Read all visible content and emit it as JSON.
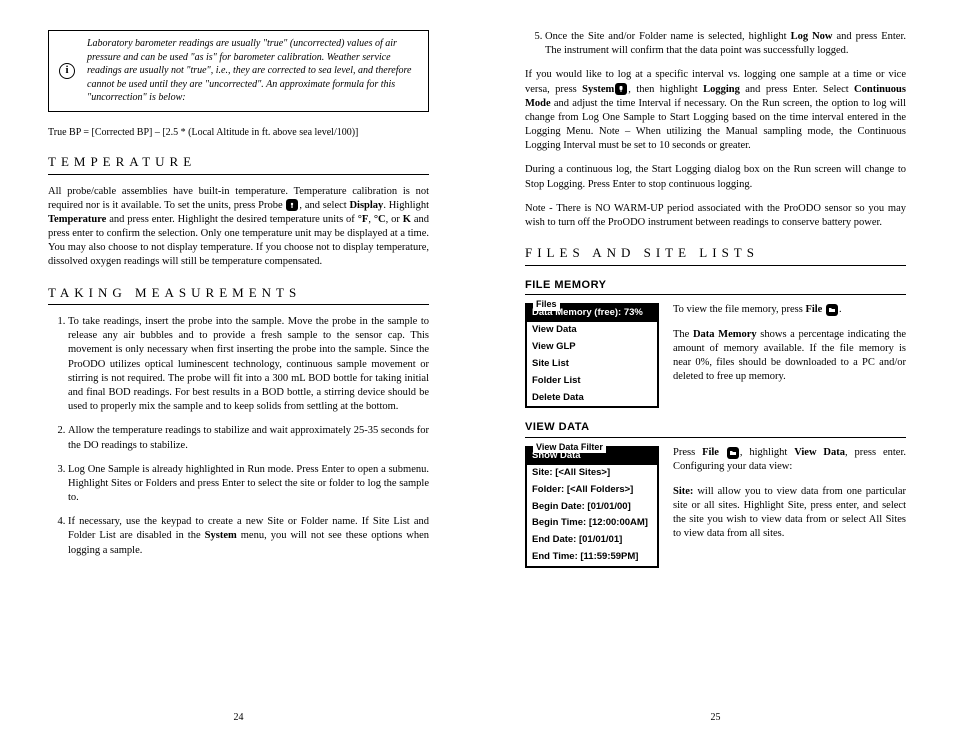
{
  "left": {
    "infoIcon": "i",
    "infoBox": "Laboratory barometer readings are usually \"true\" (uncorrected) values of air pressure and can be used \"as is\" for barometer calibration.  Weather service readings are usually not \"true\", i.e., they are corrected to sea level, and therefore cannot be used until they are \"uncorrected\".  An approximate formula for this \"uncorrection\" is below:",
    "formula": "True BP = [Corrected BP] – [2.5 * (Local Altitude in ft. above sea level/100)]",
    "tempHeading": "Temperature",
    "tempPara1a": "All probe/cable assemblies have built-in temperature.  Temperature calibration is not required nor is it available.  To set the units, press Probe ",
    "tempPara1b": ", and select ",
    "tempDisplay": "Display",
    "tempPara1c": ".  Highlight ",
    "tempTemperature": "Temperature",
    "tempPara1d": " and press enter.  Highlight the desired temperature units of ",
    "tempF": "°F",
    "tempC": "°C",
    "tempOr": ", or ",
    "tempK": "K",
    "tempPara1e": " and press enter to confirm the selection.   Only one temperature unit may be displayed at a time.  You may also choose to not display temperature.  If you choose not to display temperature, dissolved oxygen readings will still be temperature compensated.",
    "takingHeading": "Taking Measurements",
    "steps": [
      "To take readings, insert the probe into the sample.  Move the probe in the sample to release any air bubbles and to provide a fresh sample to the sensor cap.  This movement is only necessary when first inserting the probe into the sample.  Since the ProODO utilizes optical luminescent technology, continuous sample movement or stirring is not required.  The probe will fit into a 300 mL BOD bottle for taking initial and final BOD readings.  For best results in a BOD bottle, a stirring device should be used to properly mix the sample and to keep solids from settling at the bottom.",
      "Allow the temperature readings to stabilize and wait approximately 25-35 seconds for the DO readings to stabilize.",
      "Log One Sample is already highlighted in Run mode.  Press Enter to open a submenu.  Highlight Sites or Folders and press Enter to select the site or folder to log the sample to.",
      "If necessary, use the keypad to create a new Site or Folder name. If Site List and Folder List are disabled in the <b>System</b> menu, you will not see these options when logging a sample."
    ],
    "pageNum": "24"
  },
  "right": {
    "step5a": "Once the Site and/or Folder name is selected, highlight ",
    "step5LogNow": "Log Now",
    "step5b": " and press Enter.  The instrument will confirm that the data point was successfully logged.",
    "para1a": "If you would like to log at a specific interval vs. logging one sample at a time or vice versa, press ",
    "para1System": "System",
    "para1b": ", then highlight ",
    "para1Logging": "Logging",
    "para1c": " and press Enter.  Select ",
    "para1Cont": "Continuous Mode",
    "para1d": " and adjust the time Interval if necessary.   On the Run screen, the option to log will change from Log One Sample to Start Logging based on the time interval entered in the Logging Menu.  Note – When utilizing the Manual sampling mode, the  Continuous Logging Interval must be set to 10 seconds or greater.",
    "para2": "During a continuous log, the Start Logging dialog box on the Run screen will change to Stop Logging.  Press Enter to stop continuous logging.",
    "para3": "Note - There is NO WARM-UP period associated with the ProODO sensor so you may wish to turn off the ProODO instrument between readings to conserve battery power.",
    "filesHeading": "Files and Site Lists",
    "fileMemHeading": "File Memory",
    "fileMenu": {
      "legend": "Files",
      "highlight": "Data Memory (free): 73%",
      "rows": [
        "View Data",
        "View GLP",
        "Site List",
        "Folder List",
        "Delete Data"
      ]
    },
    "fileDesc1a": "To view the file memory, press ",
    "fileDesc1File": "File",
    "fileDesc1b": ".",
    "fileDesc2a": "The ",
    "fileDesc2DM": "Data Memory",
    "fileDesc2b": " shows a percentage indicating the amount of memory available.  If the file memory is near 0%, files should be downloaded to a PC and/or deleted to free up memory.",
    "viewDataHeading": "View Data",
    "viewMenu": {
      "legend": "View Data Filter",
      "highlight": "Show Data",
      "rows": [
        "Site: [<All Sites>]",
        "Folder: [<All Folders>]",
        "Begin Date: [01/01/00]",
        "Begin Time: [12:00:00AM]",
        "End Date: [01/01/01]",
        "End Time: [11:59:59PM]"
      ]
    },
    "viewDesc1a": "Press ",
    "viewDesc1File": "File",
    "viewDesc1b": ", highlight ",
    "viewDesc1VD": "View Data",
    "viewDesc1c": ", press enter. Configuring your data view:",
    "viewDesc2Site": "Site:",
    "viewDesc2": " will allow you to view data from one particular site or all sites.  Highlight Site, press enter, and select the site you wish to view data from or select All Sites to view data from all sites.",
    "pageNum": "25"
  }
}
